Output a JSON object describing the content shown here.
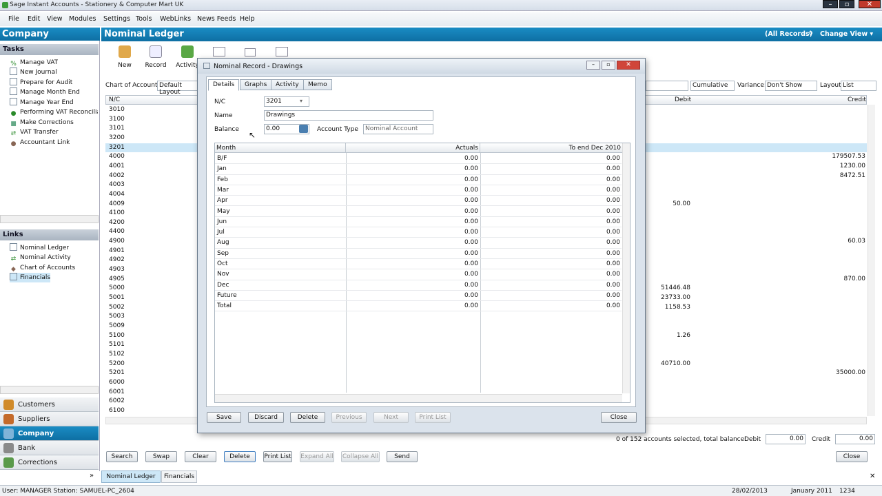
{
  "window": {
    "title": "Sage Instant Accounts - Stationery & Computer Mart UK"
  },
  "menu": [
    "File",
    "Edit",
    "View",
    "Modules",
    "Settings",
    "Tools",
    "WebLinks",
    "News Feeds",
    "Help"
  ],
  "left": {
    "title": "Company",
    "tasks_header": "Tasks",
    "tasks": [
      "Manage VAT",
      "New Journal",
      "Prepare for Audit",
      "Manage Month End",
      "Manage Year End",
      "Performing VAT Reconciliation",
      "Make Corrections",
      "VAT Transfer",
      "Accountant Link"
    ],
    "links_header": "Links",
    "links": [
      "Nominal Ledger",
      "Nominal Activity",
      "Chart of Accounts",
      "Financials"
    ],
    "nav": [
      "Customers",
      "Suppliers",
      "Company",
      "Bank",
      "Corrections"
    ]
  },
  "main": {
    "title": "Nominal Ledger",
    "records": "(All Records)",
    "change_view": "Change View",
    "toolbar": [
      "New",
      "Record",
      "Activity"
    ],
    "chart_of_accounts_label": "Chart of Accounts:",
    "chart_of_accounts_value": "Default Layout",
    "cumulative_value": "Cumulative",
    "variance_label": "Variance:",
    "variance_value": "Don't Show",
    "layout_label": "Layout:",
    "layout_value": "List",
    "col_nc": "N/C",
    "col_debit": "Debit",
    "col_credit": "Credit",
    "codes": [
      "3010",
      "3100",
      "3101",
      "3200",
      "3201",
      "4000",
      "4001",
      "4002",
      "4003",
      "4004",
      "4009",
      "4100",
      "4200",
      "4400",
      "4900",
      "4901",
      "4902",
      "4903",
      "4905",
      "5000",
      "5001",
      "5002",
      "5003",
      "5009",
      "5100",
      "5101",
      "5102",
      "5200",
      "5201",
      "6000",
      "6001",
      "6002",
      "6100"
    ],
    "debits": [
      {
        "row": 10,
        "v": "50.00"
      },
      {
        "row": 19,
        "v": "51446.48"
      },
      {
        "row": 20,
        "v": "23733.00"
      },
      {
        "row": 21,
        "v": "1158.53"
      },
      {
        "row": 24,
        "v": "1.26"
      },
      {
        "row": 27,
        "v": "40710.00"
      }
    ],
    "credits": [
      {
        "row": 5,
        "v": "179507.53"
      },
      {
        "row": 6,
        "v": "1230.00"
      },
      {
        "row": 7,
        "v": "8472.51"
      },
      {
        "row": 14,
        "v": "60.03"
      },
      {
        "row": 18,
        "v": "870.00"
      },
      {
        "row": 28,
        "v": "35000.00"
      }
    ],
    "summary": "0 of 152 accounts selected, total balance:",
    "debit_label": "Debit",
    "debit_total": "0.00",
    "credit_label": "Credit",
    "credit_total": "0.00",
    "buttons": [
      "Search",
      "Swap",
      "Clear",
      "Delete",
      "Print List",
      "Expand All",
      "Collapse All",
      "Send"
    ],
    "close": "Close",
    "bottom_tabs": [
      "Nominal Ledger",
      "Financials"
    ]
  },
  "dialog": {
    "title": "Nominal Record - Drawings",
    "tabs": [
      "Details",
      "Graphs",
      "Activity",
      "Memo"
    ],
    "nc_label": "N/C",
    "nc_value": "3201",
    "name_label": "Name",
    "name_value": "Drawings",
    "balance_label": "Balance",
    "balance_value": "0.00",
    "account_type_label": "Account Type",
    "account_type_value": "Nominal Account",
    "col_month": "Month",
    "col_actuals": "Actuals",
    "col_to_end": "To end Dec 2010",
    "rows": [
      [
        "B/F",
        "0.00",
        "0.00"
      ],
      [
        "Jan",
        "0.00",
        "0.00"
      ],
      [
        "Feb",
        "0.00",
        "0.00"
      ],
      [
        "Mar",
        "0.00",
        "0.00"
      ],
      [
        "Apr",
        "0.00",
        "0.00"
      ],
      [
        "May",
        "0.00",
        "0.00"
      ],
      [
        "Jun",
        "0.00",
        "0.00"
      ],
      [
        "Jul",
        "0.00",
        "0.00"
      ],
      [
        "Aug",
        "0.00",
        "0.00"
      ],
      [
        "Sep",
        "0.00",
        "0.00"
      ],
      [
        "Oct",
        "0.00",
        "0.00"
      ],
      [
        "Nov",
        "0.00",
        "0.00"
      ],
      [
        "Dec",
        "0.00",
        "0.00"
      ],
      [
        "Future",
        "0.00",
        "0.00"
      ],
      [
        "Total",
        "0.00",
        "0.00"
      ]
    ],
    "buttons": [
      "Save",
      "Discard",
      "Delete",
      "Previous",
      "Next",
      "Print List"
    ],
    "close": "Close"
  },
  "status": {
    "user": "User: MANAGER Station: SAMUEL-PC_2604",
    "date": "28/02/2013",
    "period": "January 2011",
    "code": "1234"
  }
}
